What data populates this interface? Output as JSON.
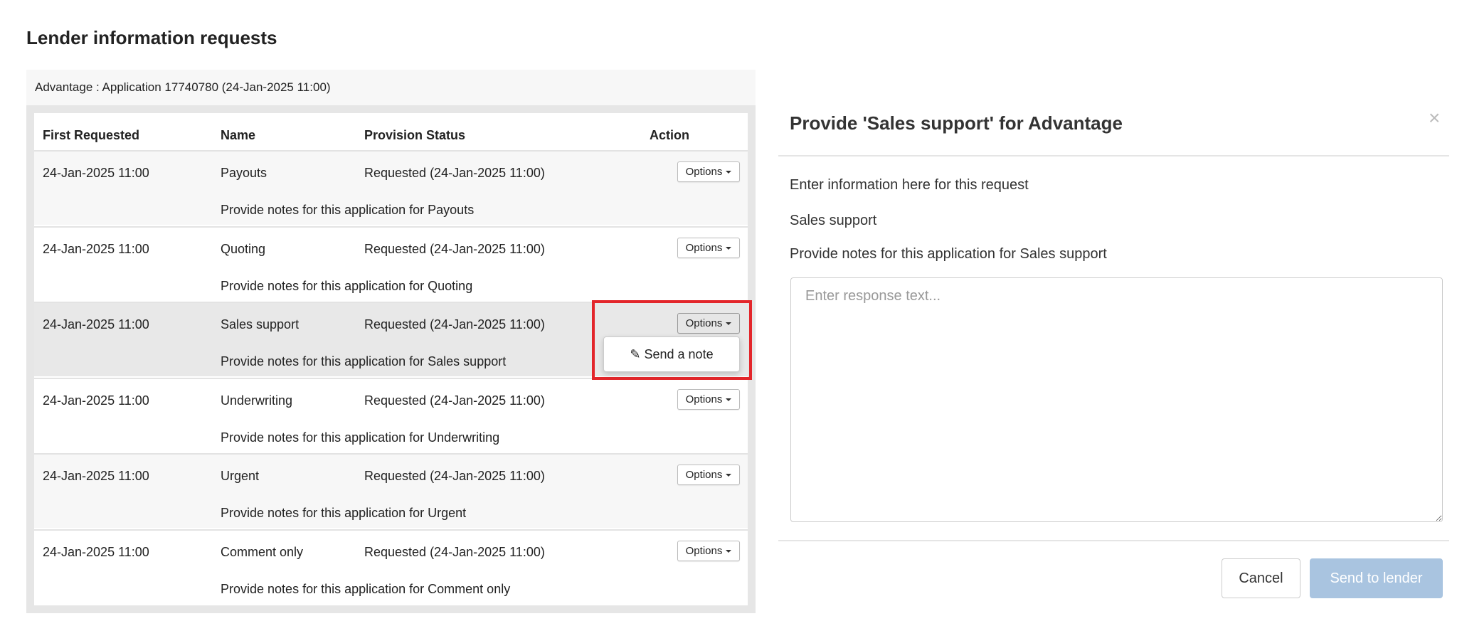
{
  "page_title": "Lender information requests",
  "panel": {
    "header": "Advantage : Application 17740780 (24-Jan-2025 11:00)",
    "columns": [
      "First Requested",
      "Name",
      "Provision Status",
      "Action"
    ],
    "rows": [
      {
        "first_requested": "24-Jan-2025 11:00",
        "name": "Payouts",
        "status": "Requested (24-Jan-2025 11:00)",
        "note": "Provide notes for this application for Payouts",
        "action": "Options"
      },
      {
        "first_requested": "24-Jan-2025 11:00",
        "name": "Quoting",
        "status": "Requested (24-Jan-2025 11:00)",
        "note": "Provide notes for this application for Quoting",
        "action": "Options"
      },
      {
        "first_requested": "24-Jan-2025 11:00",
        "name": "Sales support",
        "status": "Requested (24-Jan-2025 11:00)",
        "note": "Provide notes for this application for Sales support",
        "action": "Options"
      },
      {
        "first_requested": "24-Jan-2025 11:00",
        "name": "Underwriting",
        "status": "Requested (24-Jan-2025 11:00)",
        "note": "Provide notes for this application for Underwriting",
        "action": "Options"
      },
      {
        "first_requested": "24-Jan-2025 11:00",
        "name": "Urgent",
        "status": "Requested (24-Jan-2025 11:00)",
        "note": "Provide notes for this application for Urgent",
        "action": "Options"
      },
      {
        "first_requested": "24-Jan-2025 11:00",
        "name": "Comment only",
        "status": "Requested (24-Jan-2025 11:00)",
        "note": "Provide notes for this application for Comment only",
        "action": "Options"
      }
    ],
    "dropdown": {
      "item": "Send a note",
      "icon": "pencil-icon"
    },
    "highlight_color": "#e3262b"
  },
  "modal": {
    "title": "Provide 'Sales support' for Advantage",
    "close": "×",
    "instruction": "Enter information here for this request",
    "request_name": "Sales support",
    "request_note": "Provide notes for this application for Sales support",
    "response_placeholder": "Enter response text...",
    "cancel_label": "Cancel",
    "send_label": "Send to lender",
    "send_color": "#a9c4e0"
  }
}
